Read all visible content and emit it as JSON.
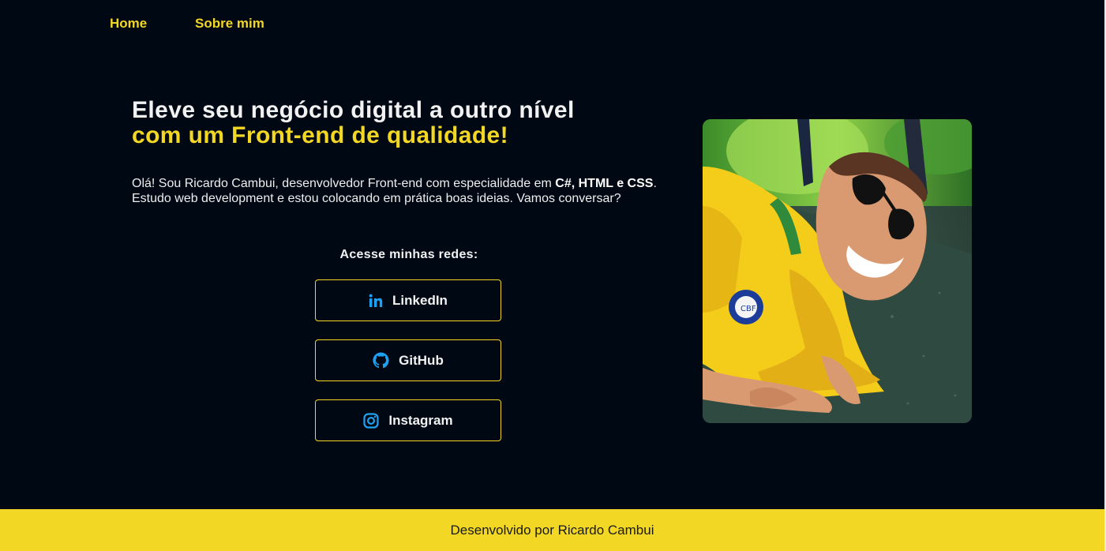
{
  "nav": {
    "home": "Home",
    "about": "Sobre mim"
  },
  "hero": {
    "title_line1": "Eleve seu negócio digital a outro nível",
    "title_line2": "com um Front-end de qualidade!",
    "intro_part1": "Olá! Sou Ricardo Cambui, desenvolvedor Front-end com especialidade em ",
    "intro_bold": "C#, HTML e CSS",
    "intro_part2": ". Estudo web development e estou colocando em prática boas ideias. Vamos conversar?"
  },
  "networks": {
    "title": "Acesse minhas redes:",
    "linkedin": "LinkedIn",
    "github": "GitHub",
    "instagram": "Instagram",
    "icon_color": "#1da1f2"
  },
  "footer": {
    "text": "Desenvolvido por Ricardo Cambui"
  },
  "colors": {
    "background": "#000814",
    "accent": "#f2d724"
  }
}
